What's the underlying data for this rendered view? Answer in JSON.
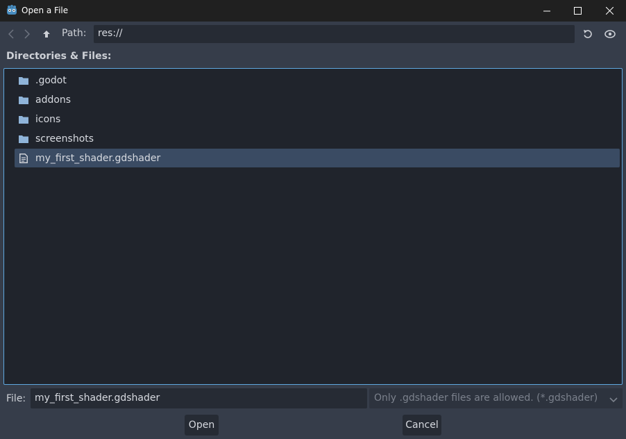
{
  "window": {
    "title": "Open a File",
    "app_icon": "godot-icon",
    "controls": [
      "minimize-icon",
      "maximize-icon",
      "close-icon"
    ]
  },
  "toolbar": {
    "back_icon": "chevron-left-icon",
    "forward_icon": "chevron-right-icon",
    "up_icon": "arrow-up-icon",
    "path_label": "Path:",
    "path_value": "res://",
    "refresh_icon": "refresh-icon",
    "toggle_hidden_icon": "eye-icon"
  },
  "browser": {
    "section_label": "Directories & Files:",
    "items": [
      {
        "name": ".godot",
        "type": "folder",
        "selected": false
      },
      {
        "name": "addons",
        "type": "folder",
        "selected": false
      },
      {
        "name": "icons",
        "type": "folder",
        "selected": false
      },
      {
        "name": "screenshots",
        "type": "folder",
        "selected": false
      },
      {
        "name": "my_first_shader.gdshader",
        "type": "file",
        "selected": true
      }
    ]
  },
  "footer": {
    "file_label": "File:",
    "file_value": "my_first_shader.gdshader",
    "filter_value": "Only .gdshader files are allowed. (*.gdshader)",
    "open_label": "Open",
    "cancel_label": "Cancel"
  },
  "colors": {
    "accent": "#5fa8e0",
    "selection": "#3a4b63",
    "folder": "#8fb4d9",
    "background": "#363d4a",
    "panel": "#20242c"
  }
}
